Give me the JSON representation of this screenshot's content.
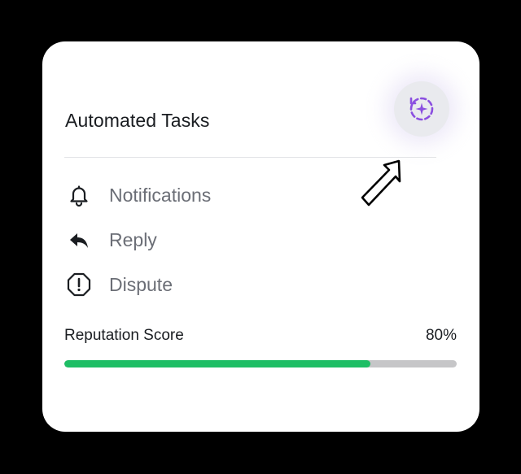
{
  "panel": {
    "title": "Automated Tasks",
    "ai_button_icon": "sparkle-refresh-icon",
    "accent_color": "#8b4fe0"
  },
  "tasks": [
    {
      "icon": "bell-icon",
      "label": "Notifications"
    },
    {
      "icon": "reply-arrow-icon",
      "label": "Reply"
    },
    {
      "icon": "alert-octagon-icon",
      "label": "Dispute"
    }
  ],
  "reputation": {
    "label": "Reputation Score",
    "value_text": "80%",
    "value": 0.78,
    "fill_color": "#1ebe65",
    "track_color": "#c6c6c8"
  },
  "cursor_icon": "mouse-pointer-icon"
}
